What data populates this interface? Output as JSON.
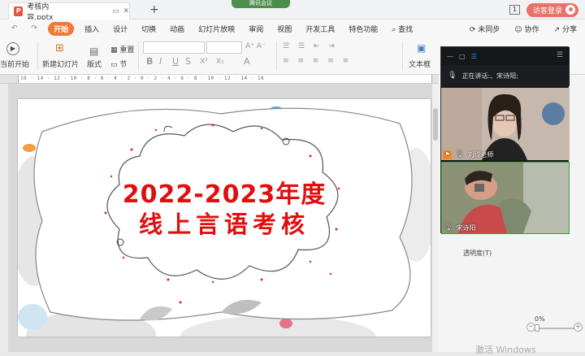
{
  "titlebar": {
    "doc_name": "考核内容.pptx",
    "ppt_icon": "P",
    "new_tab": "+",
    "meeting_pill": "腾讯会议",
    "page_badge": "1",
    "visitor_login": "访客登录"
  },
  "menu": {
    "items": [
      "开始",
      "插入",
      "设计",
      "切换",
      "动画",
      "幻灯片放映",
      "审阅",
      "视图",
      "开发工具",
      "特色功能"
    ],
    "active": "开始",
    "search": "查找",
    "right": [
      "未同步",
      "协作",
      "分享"
    ]
  },
  "ribbon": {
    "from_current": "当前开始",
    "new_slide": "新建幻灯片",
    "layout": "版式",
    "section": "节",
    "reset": "重置",
    "textbox": "文本框",
    "format_glyphs": [
      "B",
      "I",
      "U",
      "S",
      "X²",
      "X₂",
      "A"
    ]
  },
  "ruler": {
    "scale_text": "16 · 14 · 12 · 10 · 8 · 6 · 4 · 2 · 0 · 2 · 4 · 6 · 8 · 10 · 12 · 14 · 16"
  },
  "slide": {
    "line1": "2022-2023年度",
    "line2": "线上言语考核"
  },
  "right_panel": {
    "transparency_label": "透明度(T)",
    "transparency_value": "0%",
    "watermark": "激活 Windows"
  },
  "meeting": {
    "speaking_label": "正在讲话:、宋诗阳;",
    "participants": [
      {
        "name": "刘玲老师",
        "role": "host"
      },
      {
        "name": "宋诗阳",
        "role": "member"
      }
    ]
  },
  "colors": {
    "accent_orange": "#f07a35",
    "title_red": "#e00f0f",
    "meeting_green": "#3da13d"
  }
}
